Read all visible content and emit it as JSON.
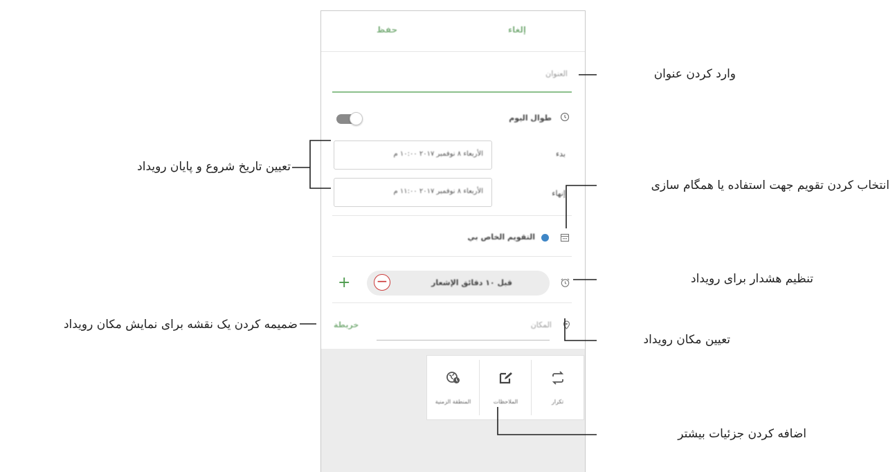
{
  "phone": {
    "top_bar": {
      "right_button": "إلغاء",
      "left_button": "حفظ"
    },
    "title_field": {
      "placeholder": "العنوان"
    },
    "all_day": {
      "label": "طوال اليوم",
      "icon": "clock-icon",
      "toggle_on": true
    },
    "start": {
      "label": "بدء",
      "value": "الأربعاء ٨ نوفمبر ٢٠١٧ ١٠:٠٠ م"
    },
    "end": {
      "label": "إنهاء",
      "value": "الأربعاء ٨ نوفمبر ٢٠١٧ ١١:٠٠ م"
    },
    "calendar": {
      "label": "التقويم الخاص بي",
      "icon": "calendar-icon",
      "color": "#3f86c6"
    },
    "alarm": {
      "value": "قبل ١٠ دقائق الإشعار",
      "icon": "alarm-icon"
    },
    "location": {
      "placeholder": "المكان",
      "map_button": "خريطة",
      "icon": "location-pin-icon"
    },
    "more_details": [
      {
        "label": "تكرار",
        "icon": "repeat-icon"
      },
      {
        "label": "الملاحظات",
        "icon": "note-edit-icon"
      },
      {
        "label": "المنطقة الزمنية",
        "icon": "timezone-icon"
      }
    ]
  },
  "annotations": {
    "enter_title": "وارد كردن عنوان",
    "set_dates": "تعیین تاریخ شروع و پایان رویداد",
    "select_calendar": "انتخاب كردن تقویم جهت استفاده یا همگام سازی",
    "set_alarm": "تنظیم هشدار برای رویداد",
    "attach_map": "ضمیمه كردن یک نقشه برای نمایش مكان رویداد",
    "set_location": "تعیین مكان رویداد",
    "add_details": "اضافه كردن جزئیات بیشتر"
  },
  "colors": {
    "accent_green": "#5a9a5a",
    "title_underline": "#8cc08c",
    "minus_red": "#cc3a3a"
  }
}
